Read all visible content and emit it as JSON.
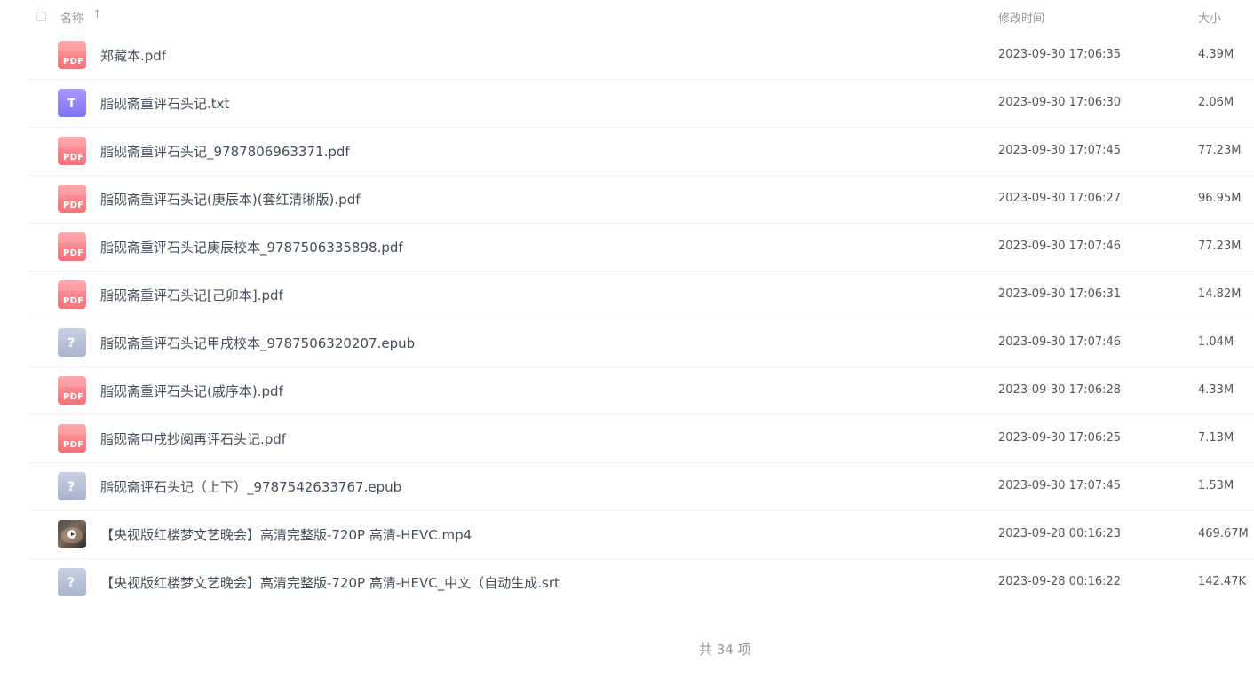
{
  "header": {
    "name_label": "名称",
    "sort_icon": "arrow-up-icon",
    "sort_glyph": "↑",
    "time_label": "修改时间",
    "size_label": "大小"
  },
  "icon_labels": {
    "pdf": "PDF",
    "txt": "T",
    "unknown": "?"
  },
  "files": [
    {
      "icon": "pdf",
      "name": "郑藏本.pdf",
      "modified": "2023-09-30 17:06:35",
      "size": "4.39M"
    },
    {
      "icon": "txt",
      "name": "脂砚斋重评石头记.txt",
      "modified": "2023-09-30 17:06:30",
      "size": "2.06M"
    },
    {
      "icon": "pdf",
      "name": "脂砚斋重评石头记_9787806963371.pdf",
      "modified": "2023-09-30 17:07:45",
      "size": "77.23M"
    },
    {
      "icon": "pdf",
      "name": "脂砚斋重评石头记(庚辰本)(套红清晰版).pdf",
      "modified": "2023-09-30 17:06:27",
      "size": "96.95M"
    },
    {
      "icon": "pdf",
      "name": "脂砚斋重评石头记庚辰校本_9787506335898.pdf",
      "modified": "2023-09-30 17:07:46",
      "size": "77.23M"
    },
    {
      "icon": "pdf",
      "name": "脂砚斋重评石头记[己卯本].pdf",
      "modified": "2023-09-30 17:06:31",
      "size": "14.82M"
    },
    {
      "icon": "unknown",
      "name": "脂砚斋重评石头记甲戌校本_9787506320207.epub",
      "modified": "2023-09-30 17:07:46",
      "size": "1.04M"
    },
    {
      "icon": "pdf",
      "name": "脂砚斋重评石头记(戚序本).pdf",
      "modified": "2023-09-30 17:06:28",
      "size": "4.33M"
    },
    {
      "icon": "pdf",
      "name": "脂砚斋甲戌抄阅再评石头记.pdf",
      "modified": "2023-09-30 17:06:25",
      "size": "7.13M"
    },
    {
      "icon": "unknown",
      "name": "脂砚斋评石头记（上下）_9787542633767.epub",
      "modified": "2023-09-30 17:07:45",
      "size": "1.53M"
    },
    {
      "icon": "video",
      "name": "【央视版红楼梦文艺晚会】高清完整版-720P 高清-HEVC.mp4",
      "modified": "2023-09-28 00:16:23",
      "size": "469.67M"
    },
    {
      "icon": "unknown",
      "name": "【央视版红楼梦文艺晚会】高清完整版-720P 高清-HEVC_中文（自动生成.srt",
      "modified": "2023-09-28 00:16:22",
      "size": "142.47K"
    }
  ],
  "footer": {
    "total_text": "共 34 项"
  }
}
